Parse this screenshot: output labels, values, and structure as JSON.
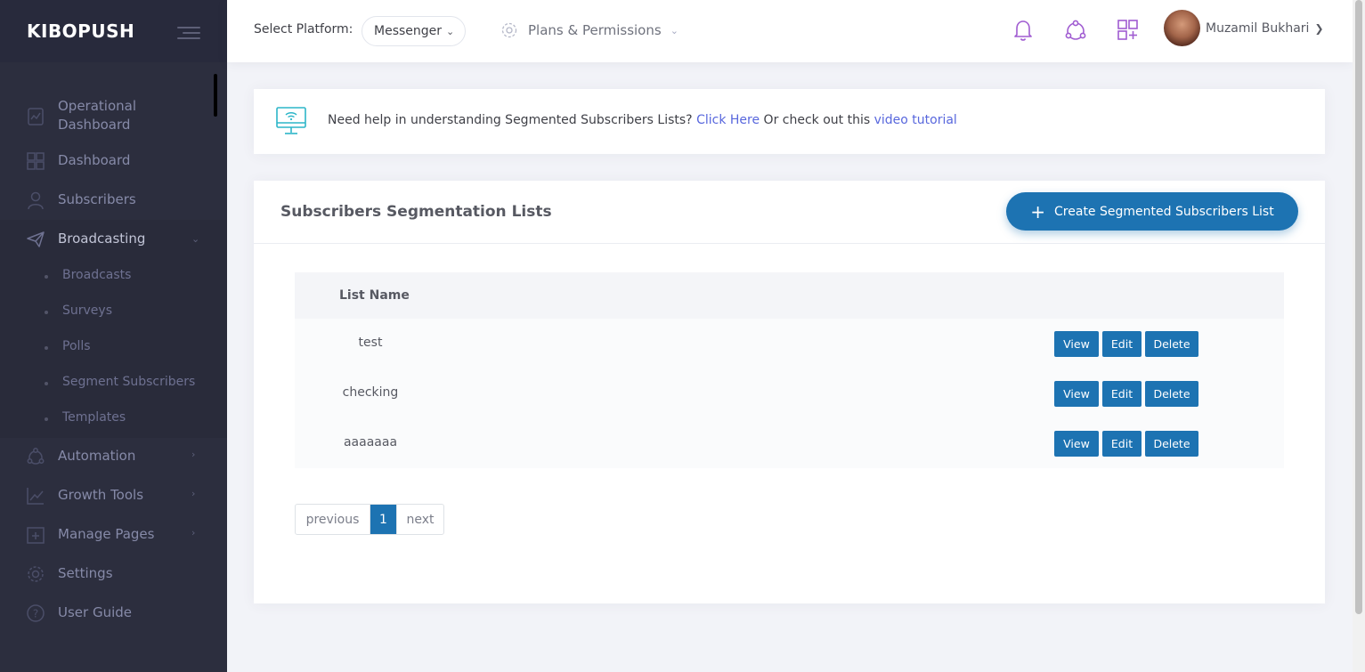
{
  "brand": {
    "name": "KIBOPUSH"
  },
  "sidebar": {
    "items": [
      {
        "label": "Operational\nDashboard",
        "icon": "operational-dashboard-icon"
      },
      {
        "label": "Dashboard",
        "icon": "dashboard-grid-icon"
      },
      {
        "label": "Subscribers",
        "icon": "user-icon"
      },
      {
        "label": "Broadcasting",
        "icon": "paper-plane-icon",
        "expanded": true
      },
      {
        "label": "Automation",
        "icon": "automation-icon"
      },
      {
        "label": "Growth Tools",
        "icon": "chart-line-icon"
      },
      {
        "label": "Manage Pages",
        "icon": "add-page-icon"
      },
      {
        "label": "Settings",
        "icon": "gear-icon"
      },
      {
        "label": "User Guide",
        "icon": "question-icon"
      }
    ],
    "submenu": [
      "Broadcasts",
      "Surveys",
      "Polls",
      "Segment Subscribers",
      "Templates"
    ]
  },
  "header": {
    "platform_label": "Select Platform:",
    "platform_value": "Messenger",
    "plans_label": "Plans & Permissions",
    "user_name": "Muzamil Bukhari",
    "icons": [
      "bell-icon",
      "users-circle-icon",
      "apps-icon"
    ],
    "accent": "#a05cd1"
  },
  "help": {
    "text_before": "Need help in understanding Segmented Subscribers Lists?",
    "link1": "Click Here",
    "text_middle": "Or check out this",
    "link2": "video tutorial"
  },
  "portlet": {
    "title": "Subscribers Segmentation Lists",
    "create_button": "Create Segmented Subscribers List",
    "table": {
      "columns": [
        "List Name"
      ],
      "rows": [
        {
          "name": "test"
        },
        {
          "name": "checking"
        },
        {
          "name": "aaaaaaa"
        }
      ],
      "actions": {
        "view": "View",
        "edit": "Edit",
        "delete": "Delete"
      }
    },
    "pagination": {
      "previous": "previous",
      "current": "1",
      "next": "next"
    }
  },
  "colors": {
    "primary": "#1d73b2",
    "link": "#5867dd",
    "sidebar_bg": "#2c2e3e"
  }
}
